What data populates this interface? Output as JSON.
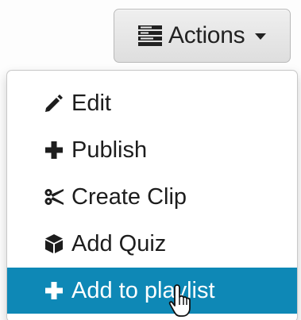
{
  "actions_button": {
    "label": "Actions",
    "icon": "menu-list-icon",
    "caret_icon": "caret-down-icon"
  },
  "dropdown": {
    "items": [
      {
        "label": "Edit",
        "icon": "pencil-icon"
      },
      {
        "label": "Publish",
        "icon": "plus-icon"
      },
      {
        "label": "Create Clip",
        "icon": "scissors-icon"
      },
      {
        "label": "Add Quiz",
        "icon": "cube-icon"
      },
      {
        "label": "Add to playlist",
        "icon": "plus-icon",
        "highlighted": true
      }
    ]
  },
  "colors": {
    "highlight": "#0e88b6",
    "text": "#1d1d1d",
    "button_bg": "#e6e6e6"
  },
  "cursor": {
    "icon": "hand-pointer-icon"
  }
}
